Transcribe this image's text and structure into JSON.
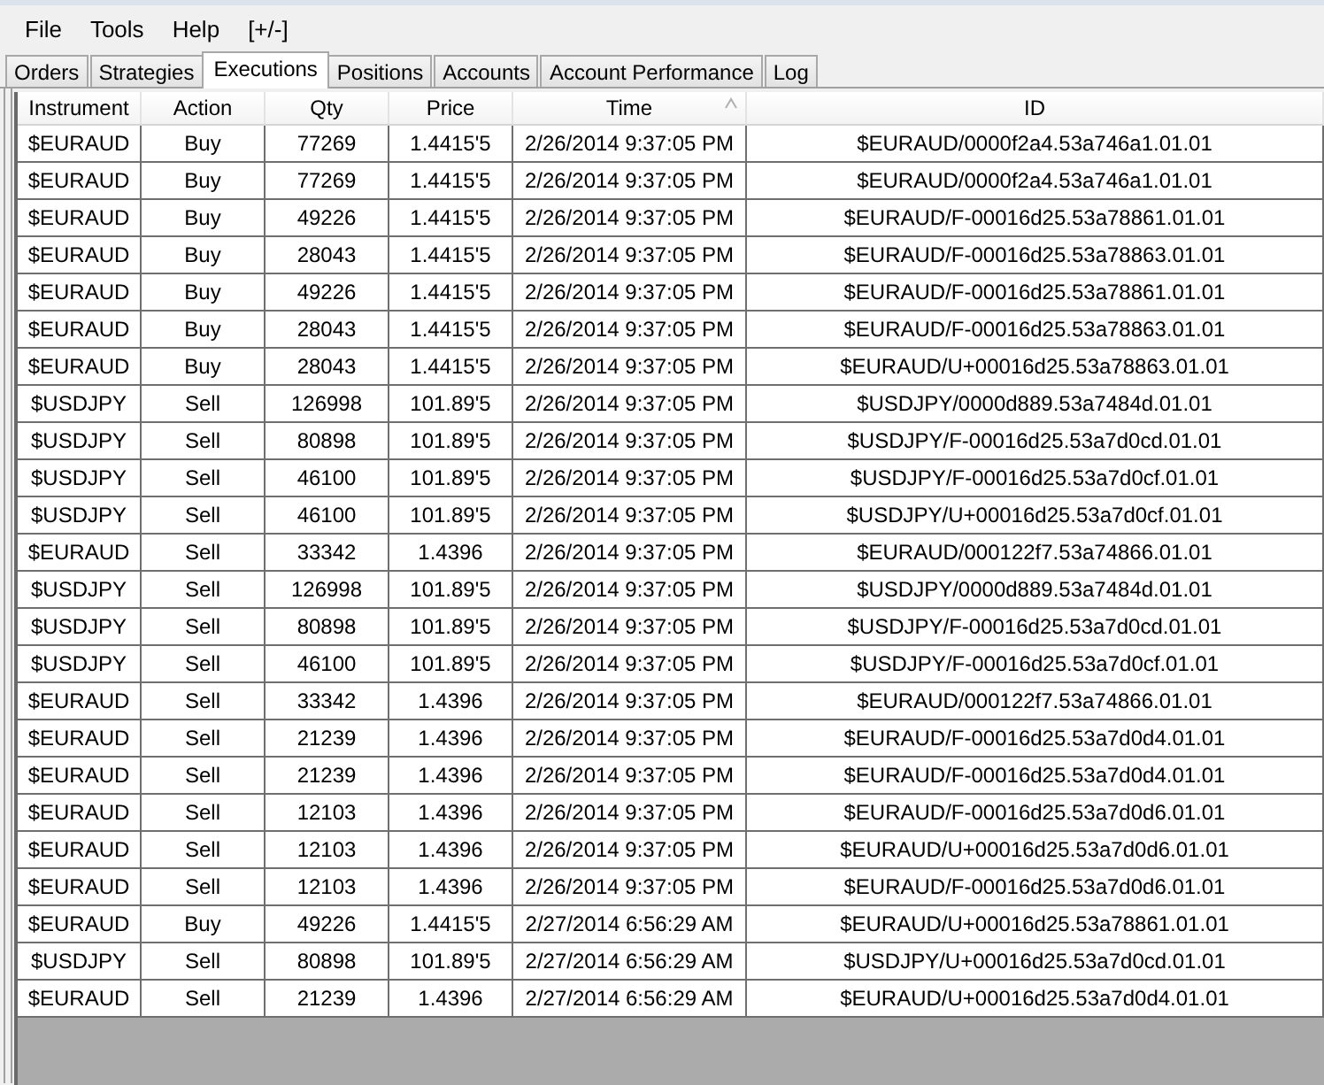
{
  "menu": [
    "File",
    "Tools",
    "Help",
    "[+/-]"
  ],
  "tabs": [
    {
      "label": "Orders",
      "selected": false
    },
    {
      "label": "Strategies",
      "selected": false
    },
    {
      "label": "Executions",
      "selected": true
    },
    {
      "label": "Positions",
      "selected": false
    },
    {
      "label": "Accounts",
      "selected": false
    },
    {
      "label": "Account Performance",
      "selected": false
    },
    {
      "label": "Log",
      "selected": false
    }
  ],
  "table": {
    "columns": [
      {
        "label": "Instrument",
        "sorted": false
      },
      {
        "label": "Action",
        "sorted": false
      },
      {
        "label": "Qty",
        "sorted": false
      },
      {
        "label": "Price",
        "sorted": false
      },
      {
        "label": "Time",
        "sorted": true
      },
      {
        "label": "ID",
        "sorted": false
      }
    ],
    "rows": [
      [
        "$EURAUD",
        "Buy",
        "77269",
        "1.4415'5",
        "2/26/2014 9:37:05 PM",
        "$EURAUD/0000f2a4.53a746a1.01.01"
      ],
      [
        "$EURAUD",
        "Buy",
        "77269",
        "1.4415'5",
        "2/26/2014 9:37:05 PM",
        "$EURAUD/0000f2a4.53a746a1.01.01"
      ],
      [
        "$EURAUD",
        "Buy",
        "49226",
        "1.4415'5",
        "2/26/2014 9:37:05 PM",
        "$EURAUD/F-00016d25.53a78861.01.01"
      ],
      [
        "$EURAUD",
        "Buy",
        "28043",
        "1.4415'5",
        "2/26/2014 9:37:05 PM",
        "$EURAUD/F-00016d25.53a78863.01.01"
      ],
      [
        "$EURAUD",
        "Buy",
        "49226",
        "1.4415'5",
        "2/26/2014 9:37:05 PM",
        "$EURAUD/F-00016d25.53a78861.01.01"
      ],
      [
        "$EURAUD",
        "Buy",
        "28043",
        "1.4415'5",
        "2/26/2014 9:37:05 PM",
        "$EURAUD/F-00016d25.53a78863.01.01"
      ],
      [
        "$EURAUD",
        "Buy",
        "28043",
        "1.4415'5",
        "2/26/2014 9:37:05 PM",
        "$EURAUD/U+00016d25.53a78863.01.01"
      ],
      [
        "$USDJPY",
        "Sell",
        "126998",
        "101.89'5",
        "2/26/2014 9:37:05 PM",
        "$USDJPY/0000d889.53a7484d.01.01"
      ],
      [
        "$USDJPY",
        "Sell",
        "80898",
        "101.89'5",
        "2/26/2014 9:37:05 PM",
        "$USDJPY/F-00016d25.53a7d0cd.01.01"
      ],
      [
        "$USDJPY",
        "Sell",
        "46100",
        "101.89'5",
        "2/26/2014 9:37:05 PM",
        "$USDJPY/F-00016d25.53a7d0cf.01.01"
      ],
      [
        "$USDJPY",
        "Sell",
        "46100",
        "101.89'5",
        "2/26/2014 9:37:05 PM",
        "$USDJPY/U+00016d25.53a7d0cf.01.01"
      ],
      [
        "$EURAUD",
        "Sell",
        "33342",
        "1.4396",
        "2/26/2014 9:37:05 PM",
        "$EURAUD/000122f7.53a74866.01.01"
      ],
      [
        "$USDJPY",
        "Sell",
        "126998",
        "101.89'5",
        "2/26/2014 9:37:05 PM",
        "$USDJPY/0000d889.53a7484d.01.01"
      ],
      [
        "$USDJPY",
        "Sell",
        "80898",
        "101.89'5",
        "2/26/2014 9:37:05 PM",
        "$USDJPY/F-00016d25.53a7d0cd.01.01"
      ],
      [
        "$USDJPY",
        "Sell",
        "46100",
        "101.89'5",
        "2/26/2014 9:37:05 PM",
        "$USDJPY/F-00016d25.53a7d0cf.01.01"
      ],
      [
        "$EURAUD",
        "Sell",
        "33342",
        "1.4396",
        "2/26/2014 9:37:05 PM",
        "$EURAUD/000122f7.53a74866.01.01"
      ],
      [
        "$EURAUD",
        "Sell",
        "21239",
        "1.4396",
        "2/26/2014 9:37:05 PM",
        "$EURAUD/F-00016d25.53a7d0d4.01.01"
      ],
      [
        "$EURAUD",
        "Sell",
        "21239",
        "1.4396",
        "2/26/2014 9:37:05 PM",
        "$EURAUD/F-00016d25.53a7d0d4.01.01"
      ],
      [
        "$EURAUD",
        "Sell",
        "12103",
        "1.4396",
        "2/26/2014 9:37:05 PM",
        "$EURAUD/F-00016d25.53a7d0d6.01.01"
      ],
      [
        "$EURAUD",
        "Sell",
        "12103",
        "1.4396",
        "2/26/2014 9:37:05 PM",
        "$EURAUD/U+00016d25.53a7d0d6.01.01"
      ],
      [
        "$EURAUD",
        "Sell",
        "12103",
        "1.4396",
        "2/26/2014 9:37:05 PM",
        "$EURAUD/F-00016d25.53a7d0d6.01.01"
      ],
      [
        "$EURAUD",
        "Buy",
        "49226",
        "1.4415'5",
        "2/27/2014 6:56:29 AM",
        "$EURAUD/U+00016d25.53a78861.01.01"
      ],
      [
        "$USDJPY",
        "Sell",
        "80898",
        "101.89'5",
        "2/27/2014 6:56:29 AM",
        "$USDJPY/U+00016d25.53a7d0cd.01.01"
      ],
      [
        "$EURAUD",
        "Sell",
        "21239",
        "1.4396",
        "2/27/2014 6:56:29 AM",
        "$EURAUD/U+00016d25.53a7d0d4.01.01"
      ]
    ]
  }
}
